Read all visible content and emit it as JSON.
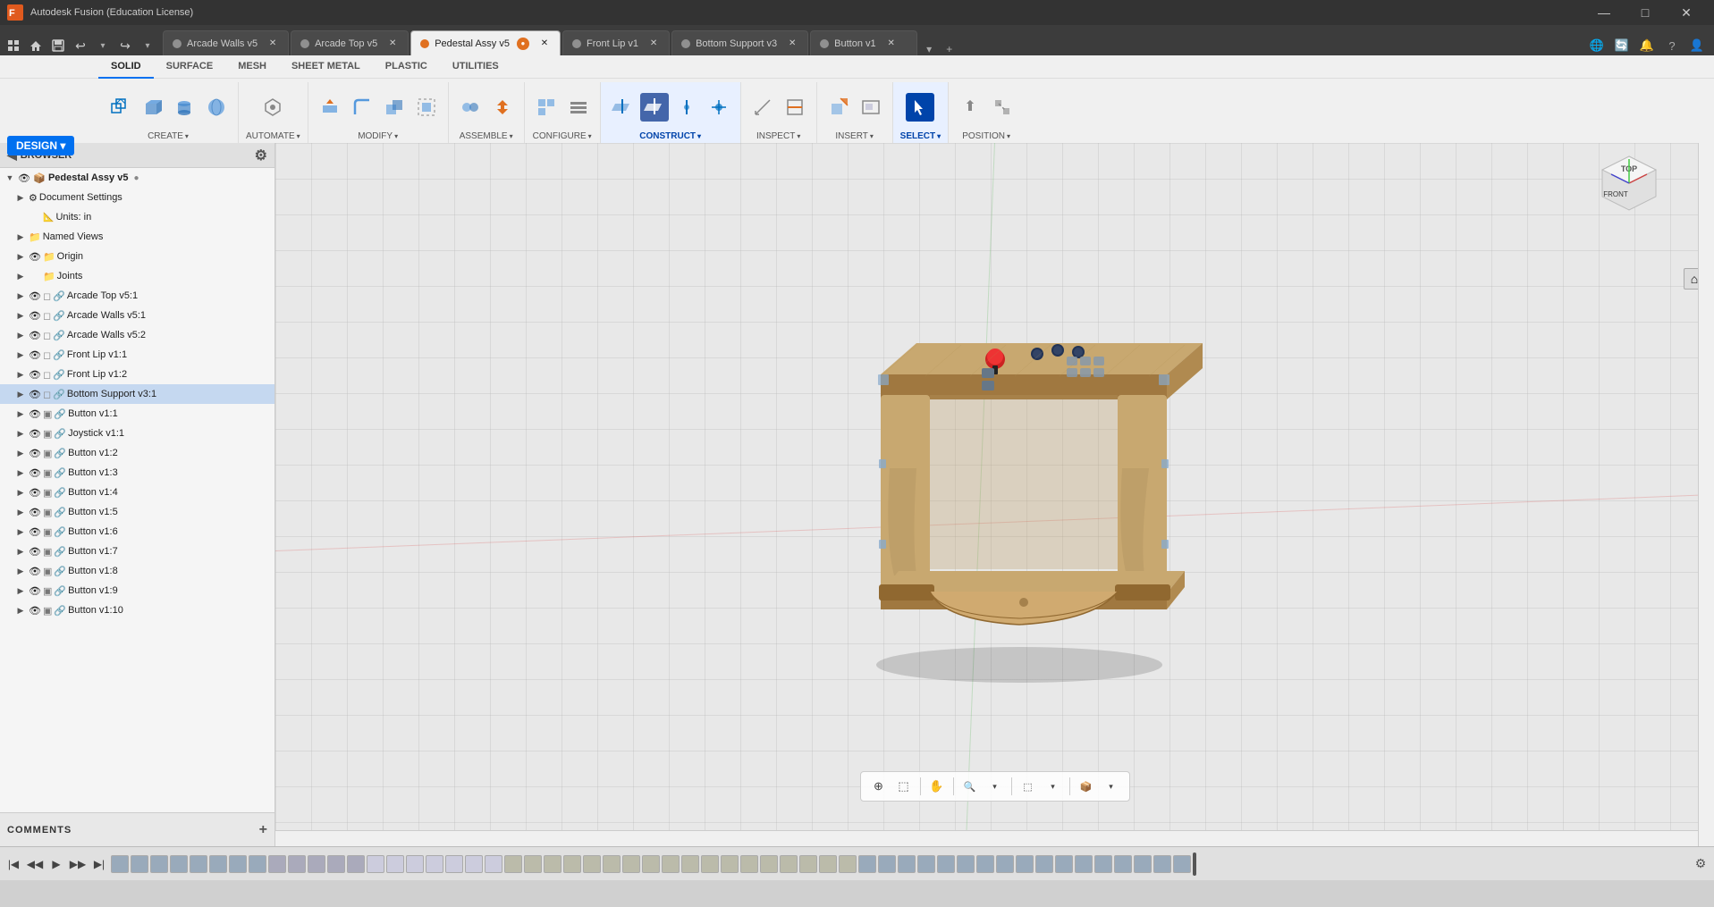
{
  "app": {
    "title": "Autodesk Fusion (Education License)",
    "icon": "F"
  },
  "window_controls": {
    "minimize": "—",
    "maximize": "□",
    "close": "✕"
  },
  "tabs": [
    {
      "id": "arcade-walls",
      "label": "Arcade Walls v5",
      "active": false,
      "color": "dot-gray"
    },
    {
      "id": "arcade-top",
      "label": "Arcade Top v5",
      "active": false,
      "color": "dot-gray"
    },
    {
      "id": "pedestal",
      "label": "Pedestal Assy v5",
      "active": true,
      "color": "dot-orange"
    },
    {
      "id": "front-lip",
      "label": "Front Lip v1",
      "active": false,
      "color": "dot-gray"
    },
    {
      "id": "bottom-support",
      "label": "Bottom Support v3",
      "active": false,
      "color": "dot-gray"
    },
    {
      "id": "button",
      "label": "Button v1",
      "active": false,
      "color": "dot-gray"
    }
  ],
  "design_button": "DESIGN ▾",
  "mode_tabs": [
    "SOLID",
    "SURFACE",
    "MESH",
    "SHEET METAL",
    "PLASTIC",
    "UTILITIES"
  ],
  "active_mode_tab": "SOLID",
  "tool_groups": [
    {
      "id": "create",
      "label": "CREATE",
      "has_arrow": true
    },
    {
      "id": "automate",
      "label": "AUTOMATE",
      "has_arrow": true
    },
    {
      "id": "modify",
      "label": "MODIFY",
      "has_arrow": true
    },
    {
      "id": "assemble",
      "label": "ASSEMBLE",
      "has_arrow": true
    },
    {
      "id": "configure",
      "label": "CONFIGURE",
      "has_arrow": true
    },
    {
      "id": "construct",
      "label": "CONSTRUCT",
      "has_arrow": true
    },
    {
      "id": "inspect",
      "label": "INSPECT",
      "has_arrow": true
    },
    {
      "id": "insert",
      "label": "INSERT",
      "has_arrow": true
    },
    {
      "id": "select",
      "label": "SELECT",
      "has_arrow": true,
      "active": true
    },
    {
      "id": "position",
      "label": "POSITION",
      "has_arrow": true
    }
  ],
  "browser": {
    "title": "BROWSER",
    "root": "Pedestal Assy v5",
    "tree_items": [
      {
        "id": "doc-settings",
        "label": "Document Settings",
        "indent": 1,
        "has_arrow": true,
        "type": "gear"
      },
      {
        "id": "units",
        "label": "Units: in",
        "indent": 2,
        "type": "units"
      },
      {
        "id": "named-views",
        "label": "Named Views",
        "indent": 1,
        "has_arrow": true,
        "type": "folder"
      },
      {
        "id": "origin",
        "label": "Origin",
        "indent": 1,
        "has_arrow": true,
        "type": "folder",
        "vis": true
      },
      {
        "id": "joints",
        "label": "Joints",
        "indent": 1,
        "has_arrow": true,
        "type": "folder"
      },
      {
        "id": "arcade-top",
        "label": "Arcade Top v5:1",
        "indent": 1,
        "has_arrow": true,
        "type": "body",
        "link": true
      },
      {
        "id": "arcade-walls-1",
        "label": "Arcade Walls v5:1",
        "indent": 1,
        "has_arrow": true,
        "type": "body",
        "link": true
      },
      {
        "id": "arcade-walls-2",
        "label": "Arcade Walls v5:2",
        "indent": 1,
        "has_arrow": true,
        "type": "body",
        "link": true
      },
      {
        "id": "front-lip-1",
        "label": "Front Lip v1:1",
        "indent": 1,
        "has_arrow": true,
        "type": "body",
        "link": true
      },
      {
        "id": "front-lip-2",
        "label": "Front Lip v1:2",
        "indent": 1,
        "has_arrow": true,
        "type": "body",
        "link": true
      },
      {
        "id": "bottom-support",
        "label": "Bottom Support v3:1",
        "indent": 1,
        "has_arrow": true,
        "type": "body",
        "link": true,
        "highlight": true
      },
      {
        "id": "button-1",
        "label": "Button v1:1",
        "indent": 1,
        "has_arrow": true,
        "type": "body2",
        "link": true
      },
      {
        "id": "joystick",
        "label": "Joystick v1:1",
        "indent": 1,
        "has_arrow": true,
        "type": "body2",
        "link": true
      },
      {
        "id": "button-2",
        "label": "Button v1:2",
        "indent": 1,
        "has_arrow": true,
        "type": "body2",
        "link": true
      },
      {
        "id": "button-3",
        "label": "Button v1:3",
        "indent": 1,
        "has_arrow": true,
        "type": "body2",
        "link": true
      },
      {
        "id": "button-4",
        "label": "Button v1:4",
        "indent": 1,
        "has_arrow": true,
        "type": "body2",
        "link": true
      },
      {
        "id": "button-5",
        "label": "Button v1:5",
        "indent": 1,
        "has_arrow": true,
        "type": "body2",
        "link": true
      },
      {
        "id": "button-6",
        "label": "Button v1:6",
        "indent": 1,
        "has_arrow": true,
        "type": "body2",
        "link": true
      },
      {
        "id": "button-7",
        "label": "Button v1:7",
        "indent": 1,
        "has_arrow": true,
        "type": "body2",
        "link": true
      },
      {
        "id": "button-8",
        "label": "Button v1:8",
        "indent": 1,
        "has_arrow": true,
        "type": "body2",
        "link": true
      },
      {
        "id": "button-9",
        "label": "Button v1:9",
        "indent": 1,
        "has_arrow": true,
        "type": "body2",
        "link": true
      },
      {
        "id": "button-10",
        "label": "Button v1:10",
        "indent": 1,
        "has_arrow": true,
        "type": "body2",
        "link": true
      }
    ]
  },
  "comments": {
    "label": "COMMENTS",
    "add_icon": "+"
  },
  "viewport": {
    "background_color": "#d8d8d0"
  },
  "gizmo": {
    "x_label": "FRONT",
    "y_label": "TOP"
  },
  "viewport_toolbar_buttons": [
    "⊕",
    "⬚",
    "✋",
    "🔍",
    "⊕🔍",
    "⬚🔍",
    "📦"
  ],
  "timeline_play_buttons": [
    "|◀",
    "◀◀",
    "▶",
    "▶▶",
    "▶|"
  ],
  "construct_label": "CONSTRUCT -"
}
